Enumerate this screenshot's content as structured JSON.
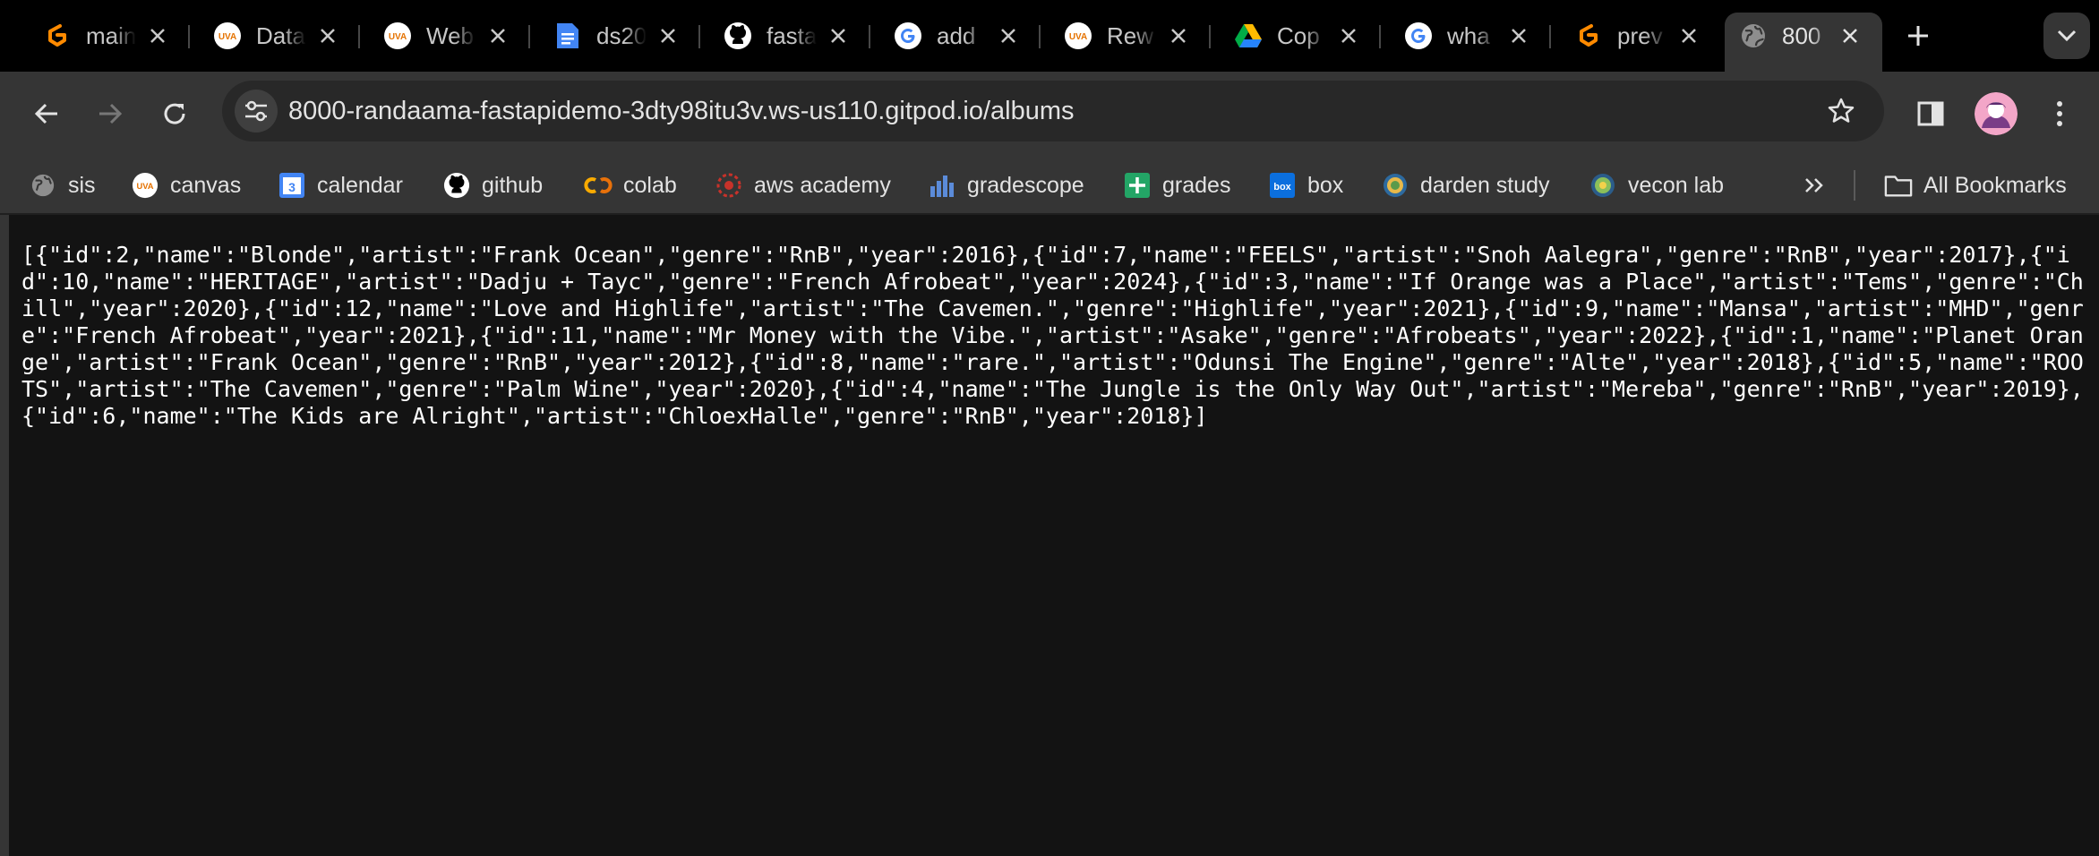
{
  "tabs": [
    {
      "title": "main",
      "icon": "gitpod-icon",
      "active": false
    },
    {
      "title": "Data",
      "icon": "uva-icon",
      "active": false
    },
    {
      "title": "Web",
      "icon": "uva-icon",
      "active": false
    },
    {
      "title": "ds20",
      "icon": "google-docs-icon",
      "active": false
    },
    {
      "title": "fasta",
      "icon": "github-icon",
      "active": false
    },
    {
      "title": "add",
      "icon": "google-icon",
      "active": false
    },
    {
      "title": "Rew",
      "icon": "uva-icon",
      "active": false
    },
    {
      "title": "Cop",
      "icon": "google-drive-icon",
      "active": false
    },
    {
      "title": "wha",
      "icon": "google-icon",
      "active": false
    },
    {
      "title": "prev",
      "icon": "gitpod-icon",
      "active": false
    },
    {
      "title": "800",
      "icon": "globe-icon",
      "active": true
    }
  ],
  "address_bar": {
    "url": "8000-randaama-fastapidemo-3dty98itu3v.ws-us110.gitpod.io/albums"
  },
  "bookmarks": [
    {
      "label": "sis",
      "icon": "globe-icon"
    },
    {
      "label": "canvas",
      "icon": "uva-icon"
    },
    {
      "label": "calendar",
      "icon": "google-calendar-icon"
    },
    {
      "label": "github",
      "icon": "github-icon"
    },
    {
      "label": "colab",
      "icon": "colab-icon"
    },
    {
      "label": "aws academy",
      "icon": "aws-academy-icon"
    },
    {
      "label": "gradescope",
      "icon": "gradescope-icon"
    },
    {
      "label": "grades",
      "icon": "google-sheets-icon"
    },
    {
      "label": "box",
      "icon": "box-icon"
    },
    {
      "label": "darden study",
      "icon": "darden-icon"
    },
    {
      "label": "vecon lab",
      "icon": "veconlab-icon"
    }
  ],
  "all_bookmarks_label": "All Bookmarks",
  "calendar_icon_text": "3",
  "box_icon_text": "box",
  "uva_icon_text": "UVA",
  "page_body": "[{\"id\":2,\"name\":\"Blonde\",\"artist\":\"Frank Ocean\",\"genre\":\"RnB\",\"year\":2016},{\"id\":7,\"name\":\"FEELS\",\"artist\":\"Snoh Aalegra\",\"genre\":\"RnB\",\"year\":2017},{\"id\":10,\"name\":\"HERITAGE\",\"artist\":\"Dadju + Tayc\",\"genre\":\"French Afrobeat\",\"year\":2024},{\"id\":3,\"name\":\"If Orange was a Place\",\"artist\":\"Tems\",\"genre\":\"Chill\",\"year\":2020},{\"id\":12,\"name\":\"Love and Highlife\",\"artist\":\"The Cavemen.\",\"genre\":\"Highlife\",\"year\":2021},{\"id\":9,\"name\":\"Mansa\",\"artist\":\"MHD\",\"genre\":\"French Afrobeat\",\"year\":2021},{\"id\":11,\"name\":\"Mr Money with the Vibe.\",\"artist\":\"Asake\",\"genre\":\"Afrobeats\",\"year\":2022},{\"id\":1,\"name\":\"Planet Orange\",\"artist\":\"Frank Ocean\",\"genre\":\"RnB\",\"year\":2012},{\"id\":8,\"name\":\"rare.\",\"artist\":\"Odunsi The Engine\",\"genre\":\"Alte\",\"year\":2018},{\"id\":5,\"name\":\"ROOTS\",\"artist\":\"The Cavemen\",\"genre\":\"Palm Wine\",\"year\":2020},{\"id\":4,\"name\":\"The Jungle is the Only Way Out\",\"artist\":\"Mereba\",\"genre\":\"RnB\",\"year\":2019},{\"id\":6,\"name\":\"The Kids are Alright\",\"artist\":\"ChloexHalle\",\"genre\":\"RnB\",\"year\":2018}]",
  "colors": {
    "tabstrip_bg": "#000000",
    "toolbar_bg": "#353535",
    "omnibox_bg": "#282828",
    "page_bg": "#131313",
    "text": "#e3e3e3"
  }
}
